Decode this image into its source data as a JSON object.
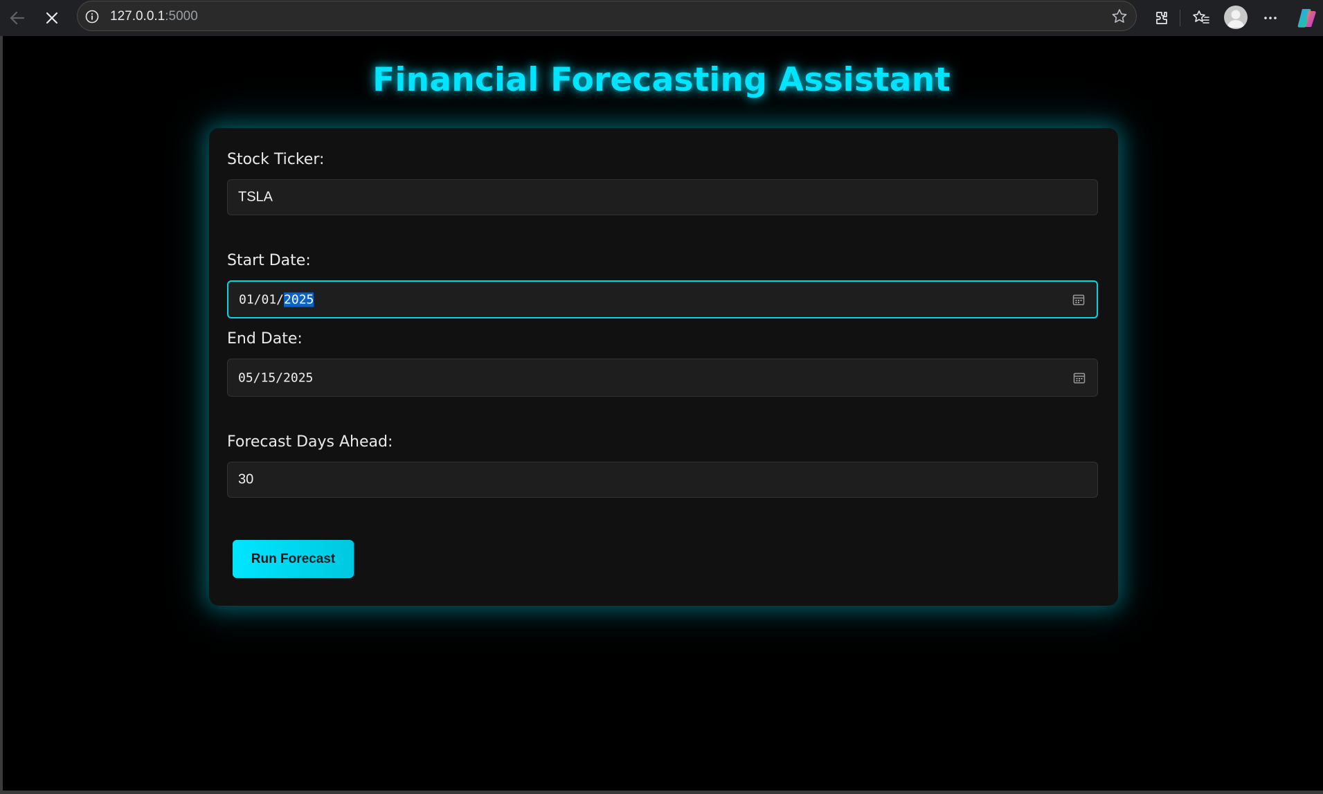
{
  "browser": {
    "url_host": "127.0.0.1",
    "url_port": ":5000"
  },
  "page": {
    "title": "Financial Forecasting Assistant"
  },
  "form": {
    "ticker_label": "Stock Ticker:",
    "ticker_value": "TSLA",
    "start_label": "Start Date:",
    "start_value_prefix": "01/01/",
    "start_value_selected": "2025",
    "end_label": "End Date:",
    "end_value": "05/15/2025",
    "days_label": "Forecast Days Ahead:",
    "days_value": "30",
    "run_label": "Run Forecast"
  },
  "colors": {
    "accent": "#00e5ff",
    "background": "#000000",
    "card": "#111111"
  },
  "icons": {
    "back": "arrow-left",
    "stop": "close-x",
    "info": "info-circle",
    "favorite": "star-outline",
    "extensions": "puzzle",
    "favorites": "star-list",
    "profile": "avatar",
    "menu": "more-horizontal",
    "copilot": "copilot-logo",
    "calendar": "calendar"
  }
}
